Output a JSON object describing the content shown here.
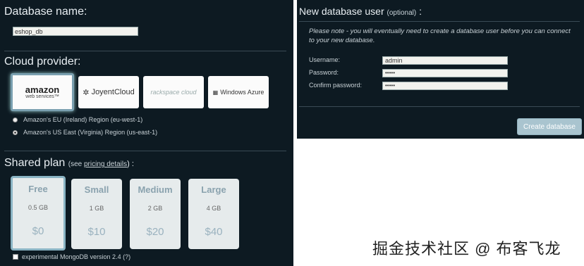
{
  "database": {
    "title": "Database name:",
    "name_value": "eshop_db"
  },
  "cloud": {
    "title": "Cloud provider:",
    "providers": [
      {
        "label": "amazon web services",
        "icon": "amazon-logo-icon"
      },
      {
        "label": "JoyentCloud",
        "icon": "joyent-logo-icon"
      },
      {
        "label": "rackspace cloud",
        "icon": "rackspace-logo-icon"
      },
      {
        "label": "Windows Azure",
        "icon": "azure-logo-icon"
      }
    ],
    "regions": [
      {
        "label": "Amazon's EU (Ireland) Region (eu-west-1)",
        "selected": false
      },
      {
        "label": "Amazon's US East (Virginia) Region (us-east-1)",
        "selected": true
      }
    ]
  },
  "plan": {
    "title": "Shared plan",
    "see": "(see ",
    "pricing_link": "pricing details",
    "close": ") :",
    "plans": [
      {
        "name": "Free",
        "size": "0.5 GB",
        "price": "$0",
        "selected": true
      },
      {
        "name": "Small",
        "size": "1 GB",
        "price": "$10",
        "selected": false
      },
      {
        "name": "Medium",
        "size": "2 GB",
        "price": "$20",
        "selected": false
      },
      {
        "name": "Large",
        "size": "4 GB",
        "price": "$40",
        "selected": false
      }
    ],
    "experimental_label": "experimental MongoDB version 2.4 (?)"
  },
  "user": {
    "title": "New database user",
    "optional": "(optional)",
    "colon": " :",
    "note": "Please note - you will eventually need to create a database user before you can connect to your new database.",
    "username_label": "Username:",
    "username_value": "admin",
    "password_label": "Password:",
    "password_value": "•••••",
    "confirm_label": "Confirm password:",
    "confirm_value": "•••••",
    "create_button": "Create database"
  },
  "watermark": "掘金技术社区 @ 布客飞龙"
}
